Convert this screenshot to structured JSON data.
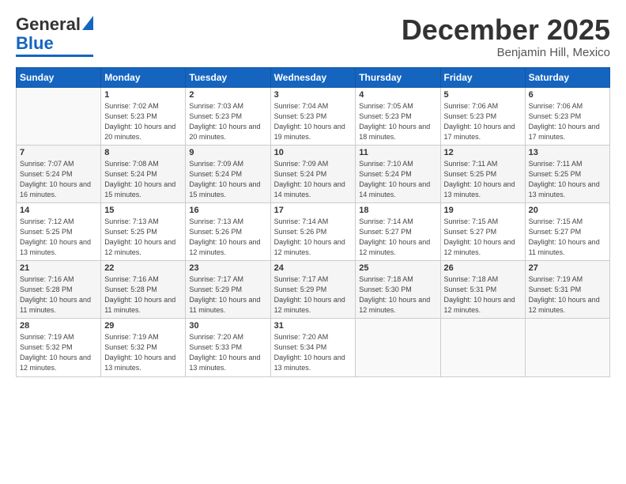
{
  "logo": {
    "general": "General",
    "blue": "Blue"
  },
  "title": "December 2025",
  "location": "Benjamin Hill, Mexico",
  "headers": [
    "Sunday",
    "Monday",
    "Tuesday",
    "Wednesday",
    "Thursday",
    "Friday",
    "Saturday"
  ],
  "weeks": [
    [
      {
        "day": "",
        "sunrise": "",
        "sunset": "",
        "daylight": ""
      },
      {
        "day": "1",
        "sunrise": "Sunrise: 7:02 AM",
        "sunset": "Sunset: 5:23 PM",
        "daylight": "Daylight: 10 hours and 20 minutes."
      },
      {
        "day": "2",
        "sunrise": "Sunrise: 7:03 AM",
        "sunset": "Sunset: 5:23 PM",
        "daylight": "Daylight: 10 hours and 20 minutes."
      },
      {
        "day": "3",
        "sunrise": "Sunrise: 7:04 AM",
        "sunset": "Sunset: 5:23 PM",
        "daylight": "Daylight: 10 hours and 19 minutes."
      },
      {
        "day": "4",
        "sunrise": "Sunrise: 7:05 AM",
        "sunset": "Sunset: 5:23 PM",
        "daylight": "Daylight: 10 hours and 18 minutes."
      },
      {
        "day": "5",
        "sunrise": "Sunrise: 7:06 AM",
        "sunset": "Sunset: 5:23 PM",
        "daylight": "Daylight: 10 hours and 17 minutes."
      },
      {
        "day": "6",
        "sunrise": "Sunrise: 7:06 AM",
        "sunset": "Sunset: 5:23 PM",
        "daylight": "Daylight: 10 hours and 17 minutes."
      }
    ],
    [
      {
        "day": "7",
        "sunrise": "Sunrise: 7:07 AM",
        "sunset": "Sunset: 5:24 PM",
        "daylight": "Daylight: 10 hours and 16 minutes."
      },
      {
        "day": "8",
        "sunrise": "Sunrise: 7:08 AM",
        "sunset": "Sunset: 5:24 PM",
        "daylight": "Daylight: 10 hours and 15 minutes."
      },
      {
        "day": "9",
        "sunrise": "Sunrise: 7:09 AM",
        "sunset": "Sunset: 5:24 PM",
        "daylight": "Daylight: 10 hours and 15 minutes."
      },
      {
        "day": "10",
        "sunrise": "Sunrise: 7:09 AM",
        "sunset": "Sunset: 5:24 PM",
        "daylight": "Daylight: 10 hours and 14 minutes."
      },
      {
        "day": "11",
        "sunrise": "Sunrise: 7:10 AM",
        "sunset": "Sunset: 5:24 PM",
        "daylight": "Daylight: 10 hours and 14 minutes."
      },
      {
        "day": "12",
        "sunrise": "Sunrise: 7:11 AM",
        "sunset": "Sunset: 5:25 PM",
        "daylight": "Daylight: 10 hours and 13 minutes."
      },
      {
        "day": "13",
        "sunrise": "Sunrise: 7:11 AM",
        "sunset": "Sunset: 5:25 PM",
        "daylight": "Daylight: 10 hours and 13 minutes."
      }
    ],
    [
      {
        "day": "14",
        "sunrise": "Sunrise: 7:12 AM",
        "sunset": "Sunset: 5:25 PM",
        "daylight": "Daylight: 10 hours and 13 minutes."
      },
      {
        "day": "15",
        "sunrise": "Sunrise: 7:13 AM",
        "sunset": "Sunset: 5:25 PM",
        "daylight": "Daylight: 10 hours and 12 minutes."
      },
      {
        "day": "16",
        "sunrise": "Sunrise: 7:13 AM",
        "sunset": "Sunset: 5:26 PM",
        "daylight": "Daylight: 10 hours and 12 minutes."
      },
      {
        "day": "17",
        "sunrise": "Sunrise: 7:14 AM",
        "sunset": "Sunset: 5:26 PM",
        "daylight": "Daylight: 10 hours and 12 minutes."
      },
      {
        "day": "18",
        "sunrise": "Sunrise: 7:14 AM",
        "sunset": "Sunset: 5:27 PM",
        "daylight": "Daylight: 10 hours and 12 minutes."
      },
      {
        "day": "19",
        "sunrise": "Sunrise: 7:15 AM",
        "sunset": "Sunset: 5:27 PM",
        "daylight": "Daylight: 10 hours and 12 minutes."
      },
      {
        "day": "20",
        "sunrise": "Sunrise: 7:15 AM",
        "sunset": "Sunset: 5:27 PM",
        "daylight": "Daylight: 10 hours and 11 minutes."
      }
    ],
    [
      {
        "day": "21",
        "sunrise": "Sunrise: 7:16 AM",
        "sunset": "Sunset: 5:28 PM",
        "daylight": "Daylight: 10 hours and 11 minutes."
      },
      {
        "day": "22",
        "sunrise": "Sunrise: 7:16 AM",
        "sunset": "Sunset: 5:28 PM",
        "daylight": "Daylight: 10 hours and 11 minutes."
      },
      {
        "day": "23",
        "sunrise": "Sunrise: 7:17 AM",
        "sunset": "Sunset: 5:29 PM",
        "daylight": "Daylight: 10 hours and 11 minutes."
      },
      {
        "day": "24",
        "sunrise": "Sunrise: 7:17 AM",
        "sunset": "Sunset: 5:29 PM",
        "daylight": "Daylight: 10 hours and 12 minutes."
      },
      {
        "day": "25",
        "sunrise": "Sunrise: 7:18 AM",
        "sunset": "Sunset: 5:30 PM",
        "daylight": "Daylight: 10 hours and 12 minutes."
      },
      {
        "day": "26",
        "sunrise": "Sunrise: 7:18 AM",
        "sunset": "Sunset: 5:31 PM",
        "daylight": "Daylight: 10 hours and 12 minutes."
      },
      {
        "day": "27",
        "sunrise": "Sunrise: 7:19 AM",
        "sunset": "Sunset: 5:31 PM",
        "daylight": "Daylight: 10 hours and 12 minutes."
      }
    ],
    [
      {
        "day": "28",
        "sunrise": "Sunrise: 7:19 AM",
        "sunset": "Sunset: 5:32 PM",
        "daylight": "Daylight: 10 hours and 12 minutes."
      },
      {
        "day": "29",
        "sunrise": "Sunrise: 7:19 AM",
        "sunset": "Sunset: 5:32 PM",
        "daylight": "Daylight: 10 hours and 13 minutes."
      },
      {
        "day": "30",
        "sunrise": "Sunrise: 7:20 AM",
        "sunset": "Sunset: 5:33 PM",
        "daylight": "Daylight: 10 hours and 13 minutes."
      },
      {
        "day": "31",
        "sunrise": "Sunrise: 7:20 AM",
        "sunset": "Sunset: 5:34 PM",
        "daylight": "Daylight: 10 hours and 13 minutes."
      },
      {
        "day": "",
        "sunrise": "",
        "sunset": "",
        "daylight": ""
      },
      {
        "day": "",
        "sunrise": "",
        "sunset": "",
        "daylight": ""
      },
      {
        "day": "",
        "sunrise": "",
        "sunset": "",
        "daylight": ""
      }
    ]
  ]
}
